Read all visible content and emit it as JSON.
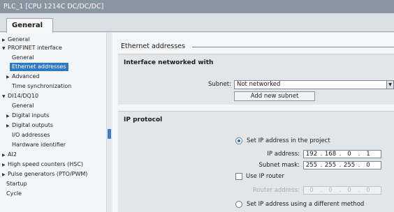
{
  "window": {
    "title": "PLC_1 [CPU 1214C DC/DC/DC]"
  },
  "tabs": [
    {
      "label": "General"
    }
  ],
  "tree": {
    "items": [
      {
        "label": "General",
        "arrow": "▶",
        "selected": false
      },
      {
        "label": "PROFINET interface",
        "arrow": "▼",
        "selected": false
      },
      {
        "label": "General",
        "arrow": "",
        "selected": false
      },
      {
        "label": "Ethernet addresses",
        "arrow": "",
        "selected": true
      },
      {
        "label": "Advanced",
        "arrow": "▶",
        "selected": false
      },
      {
        "label": "Time synchronization",
        "arrow": "",
        "selected": false
      },
      {
        "label": "DI14/DQ10",
        "arrow": "▼",
        "selected": false
      },
      {
        "label": "General",
        "arrow": "",
        "selected": false
      },
      {
        "label": "Digital inputs",
        "arrow": "▶",
        "selected": false
      },
      {
        "label": "Digital outputs",
        "arrow": "▶",
        "selected": false
      },
      {
        "label": "I/O addresses",
        "arrow": "",
        "selected": false
      },
      {
        "label": "Hardware identifier",
        "arrow": "",
        "selected": false
      },
      {
        "label": "AI2",
        "arrow": "▶",
        "selected": false
      },
      {
        "label": "High speed counters (HSC)",
        "arrow": "▶",
        "selected": false
      },
      {
        "label": "Pulse generators (PTO/PWM)",
        "arrow": "▶",
        "selected": false
      },
      {
        "label": "Startup",
        "arrow": "",
        "selected": false
      },
      {
        "label": "Cycle",
        "arrow": "",
        "selected": false
      }
    ]
  },
  "content": {
    "section_title": "Ethernet addresses",
    "interface": {
      "title": "Interface networked with",
      "subnet_label": "Subnet:",
      "subnet_value": "Not networked",
      "add_subnet_label": "Add new subnet"
    },
    "ip": {
      "title": "IP protocol",
      "set_in_project_label": "Set IP address in the project",
      "set_in_project_checked": true,
      "ip_address_label": "IP address:",
      "ip_address": [
        "192",
        "168",
        "0",
        "1"
      ],
      "subnet_mask_label": "Subnet mask:",
      "subnet_mask": [
        "255",
        "255",
        "255",
        "0"
      ],
      "use_router_label": "Use IP router",
      "use_router_checked": false,
      "router_address_label": "Router address:",
      "router_address": [
        "0",
        "0",
        "0",
        "0"
      ],
      "different_method_label": "Set IP address using a different method",
      "different_method_checked": false
    }
  }
}
